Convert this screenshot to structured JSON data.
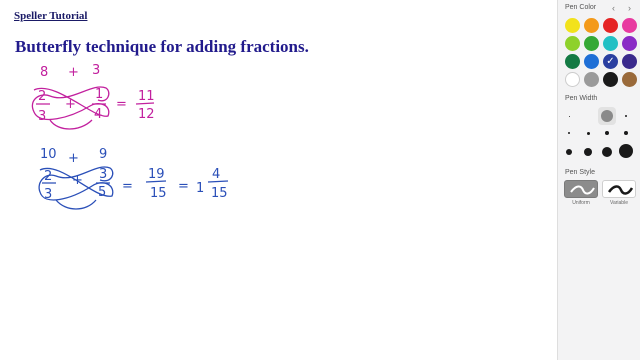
{
  "document": {
    "header": "Speller Tutorial",
    "heading": "Butterfly technique for adding fractions."
  },
  "example1": {
    "color": "#c2209e",
    "top_left": "8",
    "top_plus": "+",
    "top_right": "3",
    "num_left": "2",
    "num_right": "1",
    "den_left": "3",
    "den_right": "4",
    "op": "+",
    "equals": "=",
    "result_num": "11",
    "result_den": "12"
  },
  "example2": {
    "color": "#2a4fb8",
    "top_left": "10",
    "top_plus": "+",
    "top_right": "9",
    "num_left": "2",
    "num_right": "3",
    "den_left": "3",
    "den_right": "5",
    "op": "+",
    "equals1": "=",
    "result_num": "19",
    "result_den": "15",
    "equals2": "=",
    "mixed_whole": "1",
    "mixed_num": "4",
    "mixed_den": "15"
  },
  "panel": {
    "back_icon": "chevron-left-icon",
    "forward_icon": "chevron-right-icon",
    "back_glyph": "‹",
    "forward_glyph": "›",
    "pen_color_title": "Pen Color",
    "colors": [
      "#f2e21c",
      "#f39a1a",
      "#e52424",
      "#e83aa0",
      "#8ed12b",
      "#35a835",
      "#22c0c4",
      "#8a2bc6",
      "#147a44",
      "#1f6fd6",
      "#2a3fa0",
      "#3a2a8c",
      "#ffffff",
      "#9a9a9a",
      "#1a1a1a",
      "#9a6a3a"
    ],
    "selected_color_index": 10,
    "pen_width_title": "Pen Width",
    "selected_width_index": 1,
    "pen_style_title": "Pen Style",
    "styles": [
      {
        "label": "Uniform"
      },
      {
        "label": "Variable"
      }
    ],
    "selected_style_index": 0
  }
}
